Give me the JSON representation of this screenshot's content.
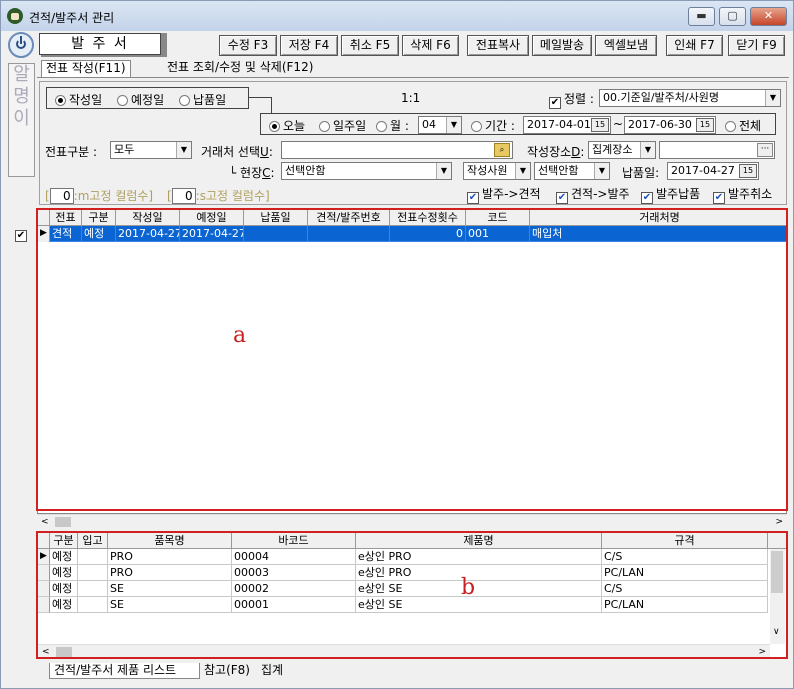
{
  "window": {
    "title": "견적/발주서 관리"
  },
  "header": {
    "mode_label": "발 주 서"
  },
  "toolbar": [
    {
      "label": "수정 F3"
    },
    {
      "label": "저장 F4"
    },
    {
      "label": "취소 F5"
    },
    {
      "label": "삭제 F6"
    },
    {
      "label": "전표복사"
    },
    {
      "label": "메일발송"
    },
    {
      "label": "엑셀보냄"
    },
    {
      "label": "인쇄 F7"
    },
    {
      "label": "닫기 F9"
    }
  ],
  "side_strip": [
    "알",
    "명",
    "이"
  ],
  "tabs": {
    "create": "전표 작성(F11)",
    "search": "전표 조회/수정 및 삭제(F12)"
  },
  "filters": {
    "date_basis": [
      "작성일",
      "예정일",
      "납품일"
    ],
    "page_indicator": "1:1",
    "sort_label": "정렬",
    "sort_value": "00.기준일/발주처/사원명",
    "period": {
      "today": "오늘",
      "week": "일주일",
      "month": "월",
      "month_value": "04",
      "range": "기간",
      "start": "2017-04-01",
      "tilde": "~",
      "end": "2017-06-30",
      "all": "전체"
    },
    "slip_type_label": "전표구분 :",
    "slip_type_value": "모두",
    "client_label": "거래처 선택",
    "client_hotkey": "U",
    "client_colon": ":",
    "place_label": "작성장소",
    "place_hotkey": "D",
    "place_colon": ":",
    "place_value": "집계장소",
    "site_prefix": "└ 현장",
    "site_hotkey": "C",
    "site_colon": ":",
    "site_value": "선택안함",
    "writer_value": "작성사원",
    "writer_select": "선택안함",
    "delivery_label": "납품일:",
    "delivery_value": "2017-04-27",
    "m_fixed_value": "0",
    "m_fixed_label": ":m고정 컬럼수]",
    "s_fixed_value": "0",
    "s_fixed_label": ":s고정 컬럼수]",
    "checks": [
      "발주->견적",
      "견적->발주",
      "발주납품",
      "발주취소"
    ]
  },
  "top_grid": {
    "columns": [
      "전표",
      "구분",
      "작성일",
      "예정일",
      "납품일",
      "견적/발주번호",
      "전표수정횟수",
      "코드",
      "거래처명"
    ],
    "rows": [
      [
        "견적",
        "예정",
        "2017-04-27",
        "2017-04-27",
        "",
        "",
        "0",
        "001",
        "매입처"
      ]
    ]
  },
  "bottom_grid": {
    "columns": [
      "구분",
      "입고",
      "품목명",
      "바코드",
      "제품명",
      "규격"
    ],
    "rows": [
      [
        "예정",
        "",
        "PRO",
        "00004",
        "e상인 PRO",
        "C/S"
      ],
      [
        "예정",
        "",
        "PRO",
        "00003",
        "e상인 PRO",
        "PC/LAN"
      ],
      [
        "예정",
        "",
        "SE",
        "00002",
        "e상인 SE",
        "C/S"
      ],
      [
        "예정",
        "",
        "SE",
        "00001",
        "e상인 SE",
        "PC/LAN"
      ]
    ]
  },
  "annotations": {
    "a": "a",
    "b": "b"
  },
  "bottom_tabs": [
    "견적/발주서 제품 리스트",
    "참고(F8)",
    "집계"
  ]
}
